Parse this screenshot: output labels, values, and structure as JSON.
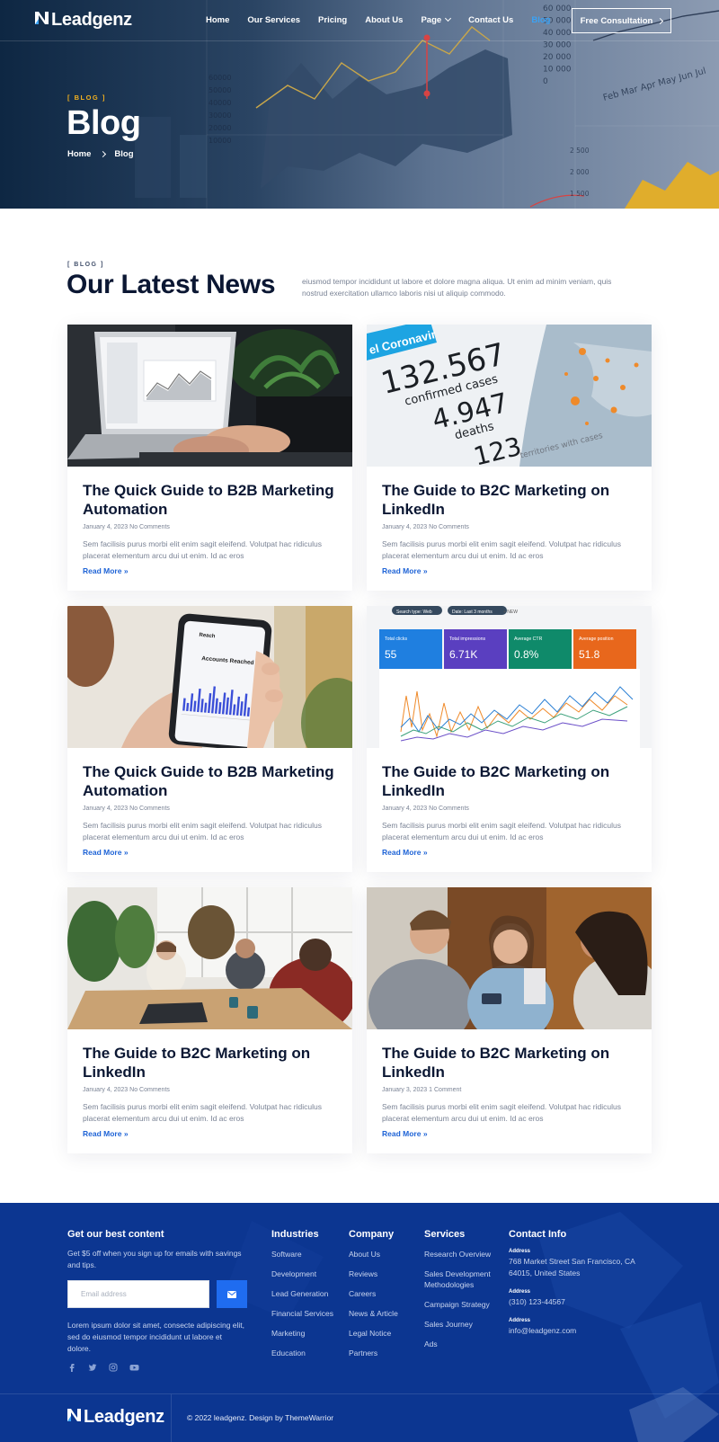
{
  "brand": {
    "name": "Leadgenz"
  },
  "nav": {
    "links": [
      "Home",
      "Our Services",
      "Pricing",
      "About Us",
      "Page",
      "Contact Us",
      "Blog"
    ],
    "active": "Blog",
    "cta_label": "Free Consultation"
  },
  "hero": {
    "eyebrow": "[ BLOG ]",
    "title": "Blog",
    "breadcrumb": [
      "Home",
      "Blog"
    ],
    "chart_numbers_left": [
      "60000",
      "50000",
      "40000",
      "30000",
      "20000",
      "10000"
    ],
    "chart_numbers_right": [
      "60 000",
      "50 000",
      "40 000",
      "30 000",
      "20 000",
      "10 000",
      "0"
    ],
    "chart_months": "Feb Mar Apr May Jun Jul",
    "chart_numbers_lower": [
      "2 500",
      "2 000",
      "1 500"
    ]
  },
  "section": {
    "eyebrow": "[ BLOG ]",
    "title": "Our Latest News",
    "description": "eiusmod tempor incididunt ut labore et dolore magna aliqua. Ut enim ad minim veniam, quis nostrud exercitation ullamco laboris nisi ut aliquip commodo."
  },
  "posts": [
    {
      "title": "The Quick Guide to B2B Marketing Automation",
      "date": "January 4, 2023",
      "comments": "No Comments",
      "excerpt": "Sem facilisis purus morbi elit enim sagit eleifend. Volutpat hac ridiculus placerat elementum arcu dui ut enim. Id ac eros",
      "link": "Read More »",
      "image": "laptop-analytics-photo"
    },
    {
      "title": "The Guide to B2C Marketing on LinkedIn",
      "date": "January 4, 2023",
      "comments": "No Comments",
      "excerpt": "Sem facilisis purus morbi elit enim sagit eleifend. Volutpat hac ridiculus placerat elementum arcu dui ut enim. Id ac eros",
      "link": "Read More »",
      "image": "coronavirus-stats-photo",
      "image_text": {
        "banner": "el Coronavir",
        "n1": "132.567",
        "l1": "confirmed cases",
        "n2": "4.947",
        "l2": "deaths",
        "n3": "123",
        "l3": "territories with cases"
      }
    },
    {
      "title": "The Quick Guide to B2B Marketing Automation",
      "date": "January 4, 2023",
      "comments": "No Comments",
      "excerpt": "Sem facilisis purus morbi elit enim sagit eleifend. Volutpat hac ridiculus placerat elementum arcu dui ut enim. Id ac eros",
      "link": "Read More »",
      "image": "phone-reach-photo",
      "image_text": {
        "header": "Reach",
        "label": "Accounts Reached"
      }
    },
    {
      "title": "The Guide to B2C Marketing on LinkedIn",
      "date": "January 4, 2023",
      "comments": "No Comments",
      "excerpt": "Sem facilisis purus morbi elit enim sagit eleifend. Volutpat hac ridiculus placerat elementum arcu dui ut enim. Id ac eros",
      "link": "Read More »",
      "image": "search-console-photo",
      "image_text": {
        "chip1": "Search type: Web",
        "chip2": "Date: Last 3 months",
        "new": "+  NEW",
        "tiles": [
          {
            "label": "Total clicks",
            "value": "55",
            "color": "#1f7fe0"
          },
          {
            "label": "Total impressions",
            "value": "6.71K",
            "color": "#5a3fc0"
          },
          {
            "label": "Average CTR",
            "value": "0.8%",
            "color": "#0f8a6a"
          },
          {
            "label": "Average position",
            "value": "51.8",
            "color": "#e8671c"
          }
        ]
      }
    },
    {
      "title": "The Guide to B2C Marketing on LinkedIn",
      "date": "January 4, 2023",
      "comments": "No Comments",
      "excerpt": "Sem facilisis purus morbi elit enim sagit eleifend. Volutpat hac ridiculus placerat elementum arcu dui ut enim. Id ac eros",
      "link": "Read More »",
      "image": "meeting-table-photo"
    },
    {
      "title": "The Guide to B2C Marketing on LinkedIn",
      "date": "January 3, 2023",
      "comments": "1 Comment",
      "excerpt": "Sem facilisis purus morbi elit enim sagit eleifend. Volutpat hac ridiculus placerat elementum arcu dui ut enim. Id ac eros",
      "link": "Read More »",
      "image": "friends-smiling-photo"
    }
  ],
  "footer": {
    "newsletter": {
      "heading": "Get our best content",
      "text": "Get $5 off when you sign up for emails with savings and tips.",
      "email_placeholder": "Email address",
      "about": "Lorem ipsum dolor sit amet, consecte adipiscing elit, sed do eiusmod tempor incididunt ut labore et dolore."
    },
    "social_icons": [
      "facebook-icon",
      "twitter-icon",
      "instagram-icon",
      "youtube-icon"
    ],
    "columns": [
      {
        "heading": "Industries",
        "items": [
          "Software",
          "Development",
          "Lead Generation",
          "Financial Services",
          "Marketing",
          "Education"
        ]
      },
      {
        "heading": "Company",
        "items": [
          "About Us",
          "Reviews",
          "Careers",
          "News & Article",
          "Legal Notice",
          "Partners"
        ]
      },
      {
        "heading": "Services",
        "items": [
          "Research Overview",
          "Sales Development Methodologies",
          "Campaign Strategy",
          "Sales Journey",
          "Ads"
        ]
      }
    ],
    "contact": {
      "heading": "Contact Info",
      "address_label": "Address",
      "address": "768 Market Street San Francisco, CA 64015, United States",
      "phone_label": "Address",
      "phone": "(310) 123-44567",
      "email_label": "Address",
      "email": "info@leadgenz.com"
    },
    "copyright": "© 2022 leadgenz. Design by ThemeWarrior"
  },
  "colors": {
    "accent": "#1e63d6",
    "eyebrow": "#f2b01e",
    "footer_bg": "#0c3691",
    "nav_active": "#3aa2f5"
  }
}
